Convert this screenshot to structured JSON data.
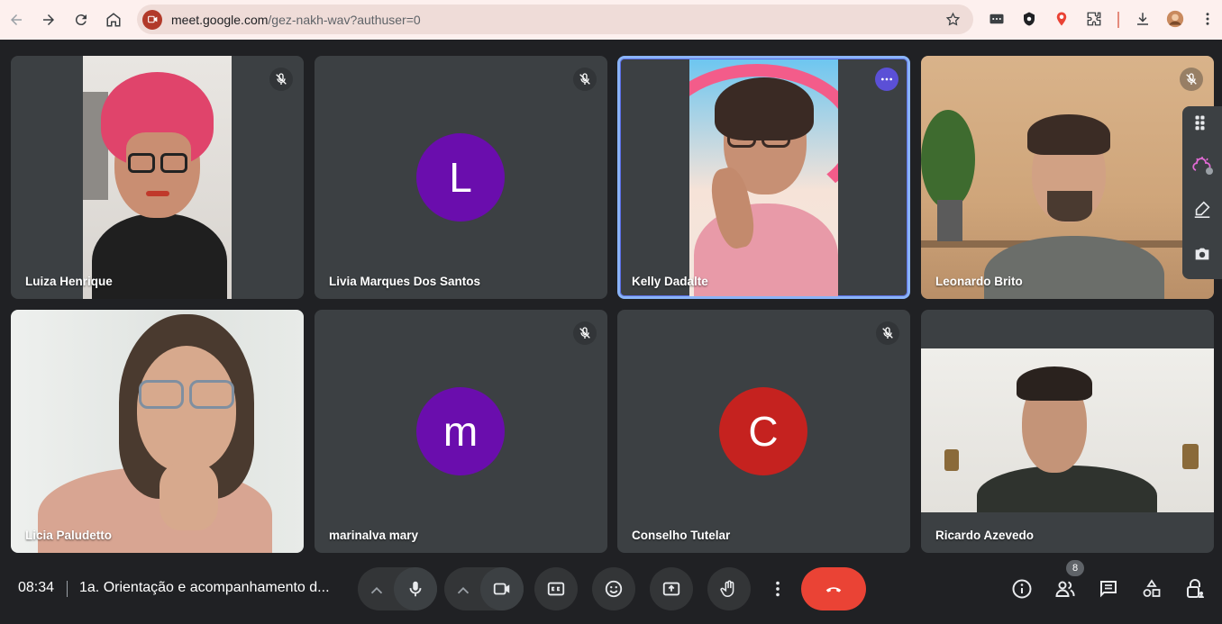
{
  "browser": {
    "url_host": "meet.google.com",
    "url_path": "/gez-nakh-wav?authuser=0"
  },
  "tiles": [
    {
      "name": "Luiza Henrique",
      "muted": true,
      "kind": "video"
    },
    {
      "name": "Livia Marques Dos Santos",
      "muted": true,
      "kind": "avatar",
      "initial": "L",
      "color": "#6a0dad"
    },
    {
      "name": "Kelly Dadalte",
      "muted": false,
      "kind": "video",
      "active": true
    },
    {
      "name": "Leonardo Brito",
      "muted": true,
      "kind": "video"
    },
    {
      "name": "Licia Paludetto",
      "muted": false,
      "kind": "video"
    },
    {
      "name": "marinalva mary",
      "muted": true,
      "kind": "avatar",
      "initial": "m",
      "color": "#6a0dad"
    },
    {
      "name": "Conselho Tutelar",
      "muted": true,
      "kind": "avatar",
      "initial": "C",
      "color": "#c5221f"
    },
    {
      "name": "Ricardo Azevedo",
      "muted": false,
      "kind": "video"
    }
  ],
  "bottom_bar": {
    "time": "08:34",
    "separator": "|",
    "meeting_title": "1a. Orientação e acompanhamento d...",
    "participant_count": "8"
  },
  "colors": {
    "background": "#202124",
    "tile": "#3c4043",
    "hangup": "#ea4335",
    "active_border": "#8ab4f8"
  }
}
